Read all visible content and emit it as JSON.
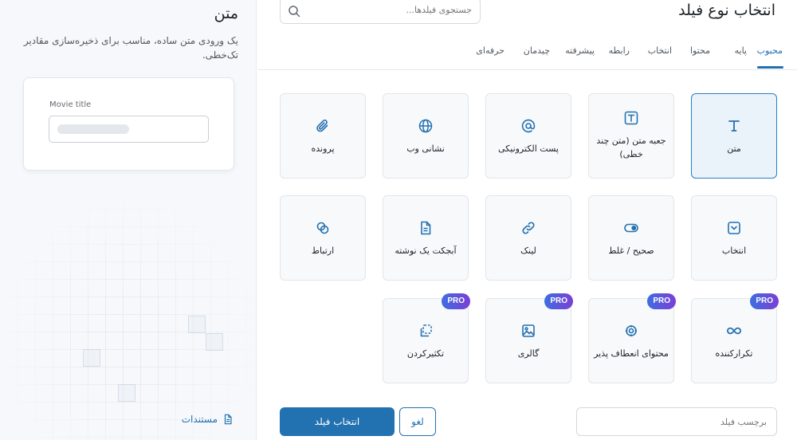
{
  "preview": {
    "title": "متن",
    "description": "یک ورودی متن ساده، مناسب برای ذخیره‌سازی مقادیر تک‌خطی.",
    "sample_label": "Movie title",
    "docs_label": "مستندات"
  },
  "header": {
    "title": "انتخاب نوع فیلد",
    "search_placeholder": "جستجوی فیلدها..."
  },
  "tabs": [
    {
      "label": "محبوب"
    },
    {
      "label": "پایه"
    },
    {
      "label": "محتوا"
    },
    {
      "label": "انتخاب"
    },
    {
      "label": "رابطه"
    },
    {
      "label": "پیشرفته"
    },
    {
      "label": "چیدمان"
    },
    {
      "label": "حرفه‌ای"
    }
  ],
  "fields": [
    {
      "label": "متن",
      "icon": "text-icon"
    },
    {
      "label": "جعبه متن (متن چند خطی)",
      "icon": "textarea-icon"
    },
    {
      "label": "پست الکترونیکی",
      "icon": "at-icon"
    },
    {
      "label": "نشانی وب",
      "icon": "globe-icon"
    },
    {
      "label": "پرونده",
      "icon": "paperclip-icon"
    },
    {
      "label": "انتخاب",
      "icon": "select-icon"
    },
    {
      "label": "صحیح / غلط",
      "icon": "toggle-icon"
    },
    {
      "label": "لینک",
      "icon": "link-icon"
    },
    {
      "label": "آبجکت یک نوشته",
      "icon": "document-icon"
    },
    {
      "label": "ارتباط",
      "icon": "relationship-icon"
    },
    {
      "label": "تکرارکننده",
      "icon": "infinity-icon",
      "badge": "PRO"
    },
    {
      "label": "محتوای انعطاف پذیر",
      "icon": "flexible-content-icon",
      "badge": "PRO"
    },
    {
      "label": "گالری",
      "icon": "gallery-icon",
      "badge": "PRO"
    },
    {
      "label": "تکثیرکردن",
      "icon": "clone-icon",
      "badge": "PRO"
    }
  ],
  "footer": {
    "label_placeholder": "برچسب فیلد",
    "cancel_label": "لغو",
    "select_label": "انتخاب فیلد"
  },
  "colors": {
    "accent": "#2271b1",
    "selected_bg": "#eaf2fa",
    "pro_gradient_start": "#3d6ee0",
    "pro_gradient_end": "#7b3fd6"
  }
}
